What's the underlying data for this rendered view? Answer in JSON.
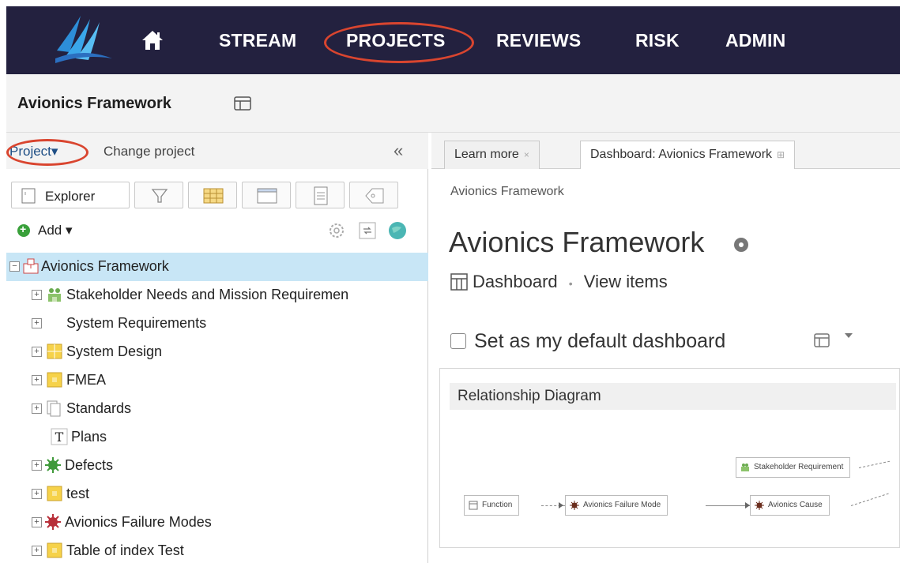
{
  "topnav": {
    "items": [
      {
        "label": "STREAM"
      },
      {
        "label": "PROJECTS"
      },
      {
        "label": "REVIEWS"
      },
      {
        "label": "RISK"
      },
      {
        "label": "ADMIN"
      }
    ],
    "highlight_color": "#d9452f",
    "bg_color": "#23213f"
  },
  "project_bar": {
    "title": "Avionics Framework"
  },
  "left_panel": {
    "project_dropdown": "Project▾",
    "change_project": "Change project",
    "collapse_glyph": "«",
    "explorer_tab": "Explorer",
    "add_label": "Add ▾",
    "tree": [
      {
        "label": "Avionics Framework",
        "icon": "project-icon",
        "expand": "−"
      },
      {
        "label": "Stakeholder Needs and Mission Requiremen",
        "icon": "stakeholder-icon",
        "expand": "+"
      },
      {
        "label": "System Requirements",
        "icon": "blank-icon",
        "expand": "+"
      },
      {
        "label": "System Design",
        "icon": "folder-grid-icon",
        "expand": "+"
      },
      {
        "label": "FMEA",
        "icon": "folder-grid-icon",
        "expand": "+"
      },
      {
        "label": "Standards",
        "icon": "documents-icon",
        "expand": "+"
      },
      {
        "label": "Plans",
        "icon": "text-icon",
        "expand": ""
      },
      {
        "label": "Defects",
        "icon": "defect-bug-icon",
        "expand": "+"
      },
      {
        "label": "test",
        "icon": "folder-grid-icon",
        "expand": "+"
      },
      {
        "label": "Avionics Failure Modes",
        "icon": "failure-bug-icon",
        "expand": "+"
      },
      {
        "label": "Table of index Test",
        "icon": "folder-grid-icon",
        "expand": "+"
      }
    ]
  },
  "right_panel": {
    "tabs": [
      {
        "label": "Learn more",
        "close": "×"
      },
      {
        "label": "Dashboard: Avionics Framework",
        "close": "⊞"
      }
    ],
    "breadcrumb": "Avionics Framework",
    "title": "Avionics Framework",
    "dashboard_link": "Dashboard",
    "separator": "•",
    "view_items_link": "View items",
    "set_default_label": "Set as my default dashboard",
    "widget": {
      "title": "Relationship Diagram",
      "nodes": [
        {
          "label": "Stakeholder Requirement",
          "icon": "stakeholder-icon"
        },
        {
          "label": "Function",
          "icon": "function-icon"
        },
        {
          "label": "Avionics Failure Mode",
          "icon": "failure-bug-icon"
        },
        {
          "label": "Avionics Cause",
          "icon": "failure-bug-icon"
        }
      ]
    }
  }
}
